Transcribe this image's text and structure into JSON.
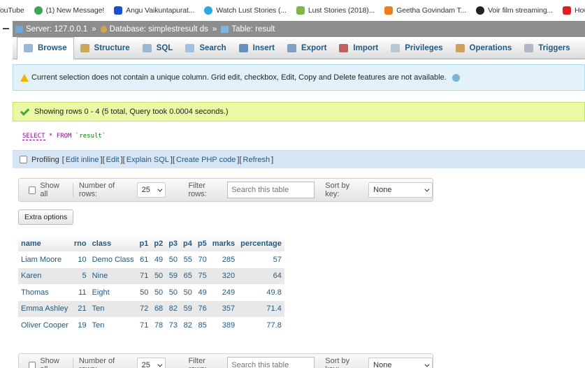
{
  "bookmarks": [
    {
      "label": "YouTube",
      "color": "#ff0000",
      "icon": "youtube-icon"
    },
    {
      "label": "(1) New Message!",
      "color": "#3ba55c",
      "icon": "message-icon"
    },
    {
      "label": "Angu Vaikuntapurat...",
      "color": "#1a4fcf",
      "icon": "s-logo-icon"
    },
    {
      "label": "Watch Lust Stories (...",
      "color": "#2ca8e0",
      "icon": "play-icon"
    },
    {
      "label": "Lust Stories (2018)...",
      "color": "#7bb84a",
      "icon": "chart-icon"
    },
    {
      "label": "Geetha Govindam T...",
      "color": "#f07b1d",
      "icon": "b-logo-icon"
    },
    {
      "label": "Voir film streaming...",
      "color": "#222222",
      "icon": "film-icon"
    },
    {
      "label": "How to Hide Galler...",
      "color": "#e02020",
      "icon": "video-icon"
    }
  ],
  "breadcrumb": {
    "server": "Server: 127.0.0.1",
    "database": "Database: simplestresult ds",
    "table": "Table: result",
    "separator": "»"
  },
  "tabs": [
    {
      "label": "Browse",
      "icon": "browse-icon",
      "active": true
    },
    {
      "label": "Structure",
      "icon": "structure-icon"
    },
    {
      "label": "SQL",
      "icon": "sql-icon"
    },
    {
      "label": "Search",
      "icon": "search-icon"
    },
    {
      "label": "Insert",
      "icon": "insert-icon"
    },
    {
      "label": "Export",
      "icon": "export-icon"
    },
    {
      "label": "Import",
      "icon": "import-icon"
    },
    {
      "label": "Privileges",
      "icon": "privileges-icon"
    },
    {
      "label": "Operations",
      "icon": "operations-icon"
    },
    {
      "label": "Triggers",
      "icon": "triggers-icon"
    }
  ],
  "notice": "Current selection does not contain a unique column. Grid edit, checkbox, Edit, Copy and Delete features are not available.",
  "success": "Showing rows 0 - 4 (5 total, Query took 0.0004 seconds.)",
  "sql": {
    "select": "SELECT",
    "star": " * ",
    "from": "FROM",
    "table": "`result`"
  },
  "profiling": {
    "label": "Profiling",
    "links": [
      "Edit inline",
      "Edit",
      "Explain SQL",
      "Create PHP code",
      "Refresh"
    ]
  },
  "nav": {
    "show_all": "Show all",
    "number_of_rows_label": "Number of rows:",
    "rows_value": "25",
    "filter_label": "Filter rows:",
    "filter_placeholder": "Search this table",
    "sort_label": "Sort by key:",
    "sort_value": "None"
  },
  "extra_options": "Extra options",
  "table": {
    "columns": [
      "name",
      "rno",
      "class",
      "p1",
      "p2",
      "p3",
      "p4",
      "p5",
      "marks",
      "percentage"
    ],
    "rows": [
      [
        "Liam Moore",
        "10",
        "Demo Class",
        "61",
        "49",
        "50",
        "55",
        "70",
        "285",
        "57"
      ],
      [
        "Karen",
        "5",
        "Nine",
        "71",
        "50",
        "59",
        "65",
        "75",
        "320",
        "64"
      ],
      [
        "Thomas",
        "11",
        "Eight",
        "50",
        "50",
        "50",
        "50",
        "49",
        "249",
        "49.8"
      ],
      [
        "Emma Ashley",
        "21",
        "Ten",
        "72",
        "68",
        "82",
        "59",
        "76",
        "357",
        "71.4"
      ],
      [
        "Oliver Cooper",
        "19",
        "Ten",
        "71",
        "78",
        "73",
        "82",
        "85",
        "389",
        "77.8"
      ]
    ]
  }
}
